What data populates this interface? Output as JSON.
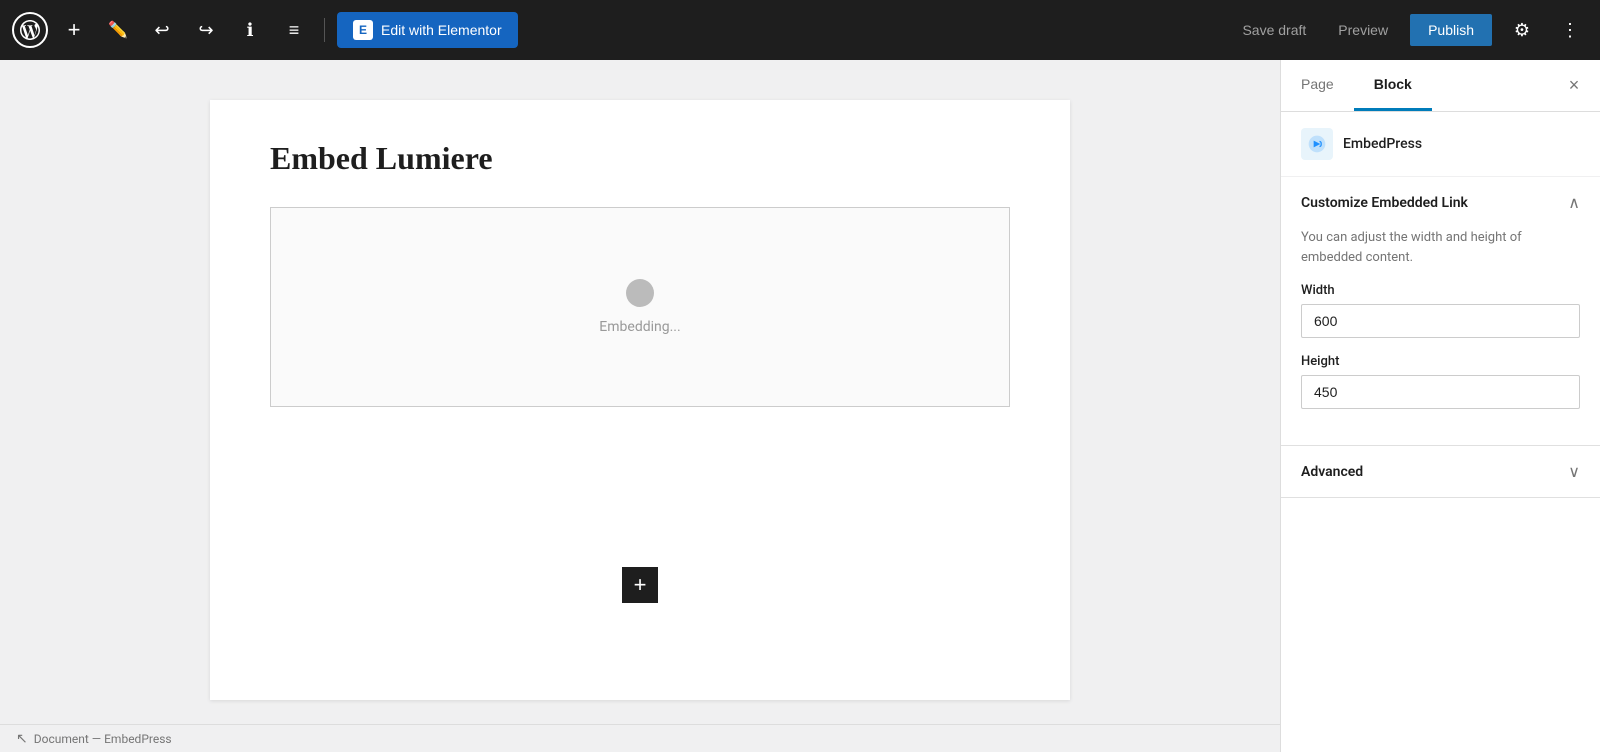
{
  "toolbar": {
    "wp_logo_alt": "WordPress",
    "add_label": "+",
    "pencil_unicode": "✏",
    "undo_unicode": "↩",
    "redo_unicode": "↪",
    "info_unicode": "ℹ",
    "list_unicode": "≡",
    "edit_elementor_label": "Edit with Elementor",
    "save_draft_label": "Save draft",
    "preview_label": "Preview",
    "publish_label": "Publish",
    "settings_unicode": "⚙",
    "more_unicode": "⋮"
  },
  "editor": {
    "page_title": "Embed Lumiere",
    "embed_loading_text": "Embedding..."
  },
  "status_bar": {
    "breadcrumb": "Document — EmbedPress",
    "cursor_symbol": "↖"
  },
  "sidebar": {
    "tab_page": "Page",
    "tab_block": "Block",
    "active_tab": "block",
    "close_label": "×",
    "plugin_name": "EmbedPress",
    "customize_section": {
      "title": "Customize Embedded Link",
      "chevron": "∧",
      "description": "You can adjust the width and height of embedded content.",
      "width_label": "Width",
      "width_value": "600",
      "height_label": "Height",
      "height_value": "450"
    },
    "advanced_section": {
      "title": "Advanced",
      "chevron": "∨"
    }
  }
}
